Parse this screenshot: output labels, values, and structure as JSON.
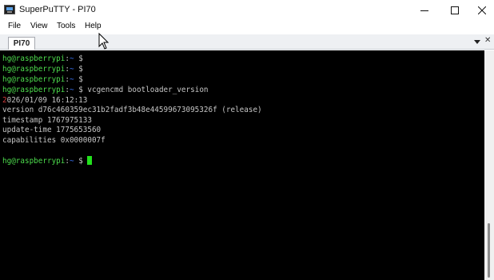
{
  "window": {
    "title": "SuperPuTTY - PI70",
    "icon": "putty-computer-icon",
    "controls": [
      "minimize-icon",
      "maximize-icon",
      "close-icon"
    ]
  },
  "menu": {
    "items": [
      "File",
      "View",
      "Tools",
      "Help"
    ]
  },
  "tabs": {
    "items": [
      {
        "label": "PI70"
      }
    ]
  },
  "terminal": {
    "lines": [
      {
        "kind": "prompt",
        "user_host": "hg@raspberrypi",
        "sep": ":",
        "path": "~",
        "symbol": " $ ",
        "command": ""
      },
      {
        "kind": "prompt",
        "user_host": "hg@raspberrypi",
        "sep": ":",
        "path": "~",
        "symbol": " $ ",
        "command": ""
      },
      {
        "kind": "prompt",
        "user_host": "hg@raspberrypi",
        "sep": ":",
        "path": "~",
        "symbol": " $ ",
        "command": ""
      },
      {
        "kind": "prompt",
        "user_host": "hg@raspberrypi",
        "sep": ":",
        "path": "~",
        "symbol": " $ ",
        "command": "vcgencmd bootloader_version"
      },
      {
        "kind": "output",
        "first_char": "2",
        "rest": "026/01/09 16:12:13"
      },
      {
        "kind": "output",
        "text": "version d76c460359ec31b2fadf3b48e44599673095326f (release)"
      },
      {
        "kind": "output",
        "text": "timestamp 1767975133"
      },
      {
        "kind": "output",
        "text": "update-time 1775653560"
      },
      {
        "kind": "output",
        "text": "capabilities 0x0000007f"
      },
      {
        "kind": "blank"
      },
      {
        "kind": "prompt_active",
        "user_host": "hg@raspberrypi",
        "sep": ":",
        "path": "~",
        "symbol": " $ "
      }
    ]
  },
  "colors": {
    "terminal_bg": "#000000",
    "terminal_text": "#c6c6c6",
    "user_host": "#4ddc4d",
    "path": "#3b78ff",
    "cursor": "#22e01c"
  }
}
